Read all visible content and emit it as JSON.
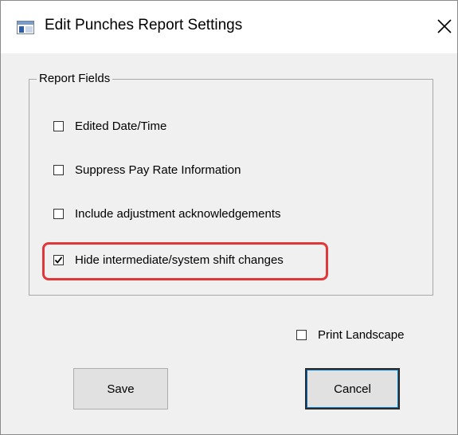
{
  "window": {
    "title": "Edit Punches Report Settings",
    "app_icon": "window-app-icon",
    "close_icon": "close-icon"
  },
  "report_fields": {
    "legend": "Report Fields",
    "options": [
      {
        "label": "Edited Date/Time",
        "checked": false
      },
      {
        "label": "Suppress Pay Rate Information",
        "checked": false
      },
      {
        "label": "Include adjustment acknowledgements",
        "checked": false
      },
      {
        "label": "Hide intermediate/system shift changes",
        "checked": true
      }
    ],
    "highlight_color": "#e0383a"
  },
  "print_landscape": {
    "label": "Print Landscape",
    "checked": false
  },
  "buttons": {
    "save_label": "Save",
    "cancel_label": "Cancel"
  },
  "colors": {
    "dialog_background": "#f0f0f0",
    "titlebar_background": "#ffffff",
    "button_background": "#e1e1e1",
    "focus_accent": "#0078d7"
  }
}
